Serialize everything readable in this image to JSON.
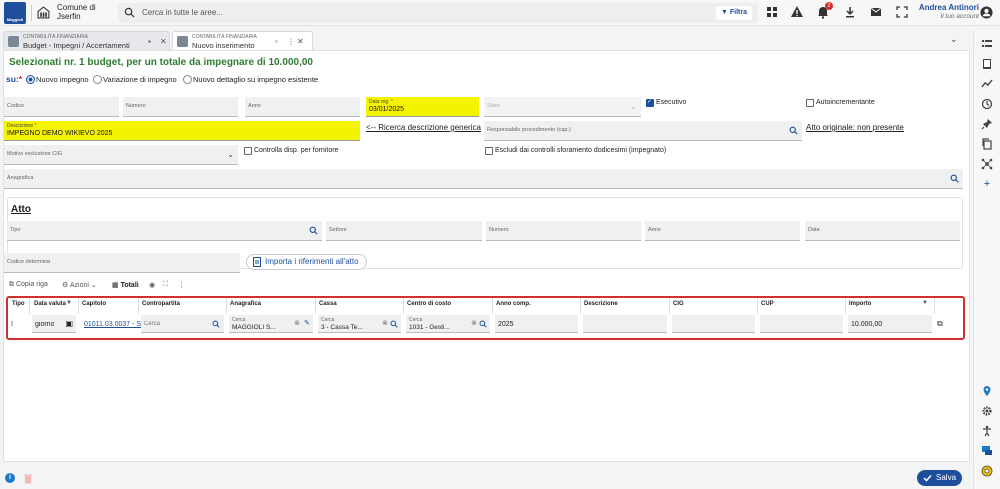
{
  "header": {
    "logo_text": "Maggioli",
    "org_line1": "Comune di",
    "org_line2": "Jserfin",
    "search_placeholder": "Cerca in tutte le aree...",
    "filter_label": "Filtra",
    "notification_count": "2",
    "user_name": "Andrea Antinori",
    "user_role": "Il tuo account"
  },
  "tabs": [
    {
      "subtitle": "CONTABILITÀ FINANZIARIA",
      "title": "Budget - Impegni / Accertamenti"
    },
    {
      "subtitle": "CONTABILITÀ FINANZIARIA",
      "title": "Nuovo inserimento"
    }
  ],
  "form": {
    "headline": "Selezionati nr. 1 budget, per un totale da impegnare di 10.000,00",
    "su_label": "su:",
    "required_mark": "*",
    "radios": [
      {
        "label": "Nuovo impegno",
        "selected": true
      },
      {
        "label": "Variazione di impegno",
        "selected": false
      },
      {
        "label": "Nuovo dettaglio su impegno esistente",
        "selected": false
      }
    ],
    "codice_label": "Codice",
    "numero_label": "Numero",
    "anno_label": "Anno",
    "data_reg_label": "Data reg.",
    "data_reg_value": "03/01/2025",
    "stato_label": "Stato",
    "esecutivo_label": "Esecutivo",
    "autoincrementante_label": "Autoincrementante",
    "descrizione_label": "Descrizione",
    "descrizione_value": "IMPEGNO DEMO WIKIEVO 2025",
    "ricerca_link": "<-- Ricerca descrizione generica",
    "responsabile_label": "Responsabile procedimento (cap.)",
    "atto_originale_link": "Atto originale: non presente",
    "motivo_label": "Motivo esclusione CIG",
    "controlla_label": "Controlla disp. per fornitore",
    "escludi_label": "Escludi dai controlli sforamento dodicesimi (impegnato)",
    "anagrafica_label": "Anagrafica"
  },
  "atto": {
    "title": "Atto",
    "tipo_label": "Tipo",
    "settore_label": "Settore",
    "numero_label": "Numero",
    "anno_label": "Anno",
    "data_label": "Data",
    "codice_det_label": "Codice determina",
    "import_button": "Importa i riferimenti all'atto"
  },
  "grid_toolbar": {
    "copia": "Copia riga",
    "azioni": "Azioni",
    "totali": "Totali"
  },
  "table": {
    "headers": [
      "Tipo",
      "Data valuta",
      "Capitolo",
      "Contropartita",
      "Anagrafica",
      "Cassa",
      "Centro di costo",
      "Anno comp.",
      "Descrizione",
      "CIG",
      "CUP",
      "Importo"
    ],
    "row": {
      "tipo": "I",
      "data_valuta": "giorno",
      "capitolo": "01011.03.0037 - S",
      "contropartita_placeholder": "Cerca",
      "anagrafica_hint": "Cerca",
      "anagrafica_value": "MAGGIOLI S...",
      "cassa_hint": "Cerca",
      "cassa_value": "3 - Cassa Te...",
      "centro_hint": "Cerca",
      "centro_value": "1031 - Gesti...",
      "anno_comp": "2025",
      "importo": "10.000,00"
    }
  },
  "footer": {
    "save_label": "Salva",
    "info_label": "i"
  },
  "colors": {
    "brand": "#1e4f9c",
    "highlight": "#f5f400",
    "headline": "#2e7d32",
    "focus_border": "#d32f2f"
  }
}
